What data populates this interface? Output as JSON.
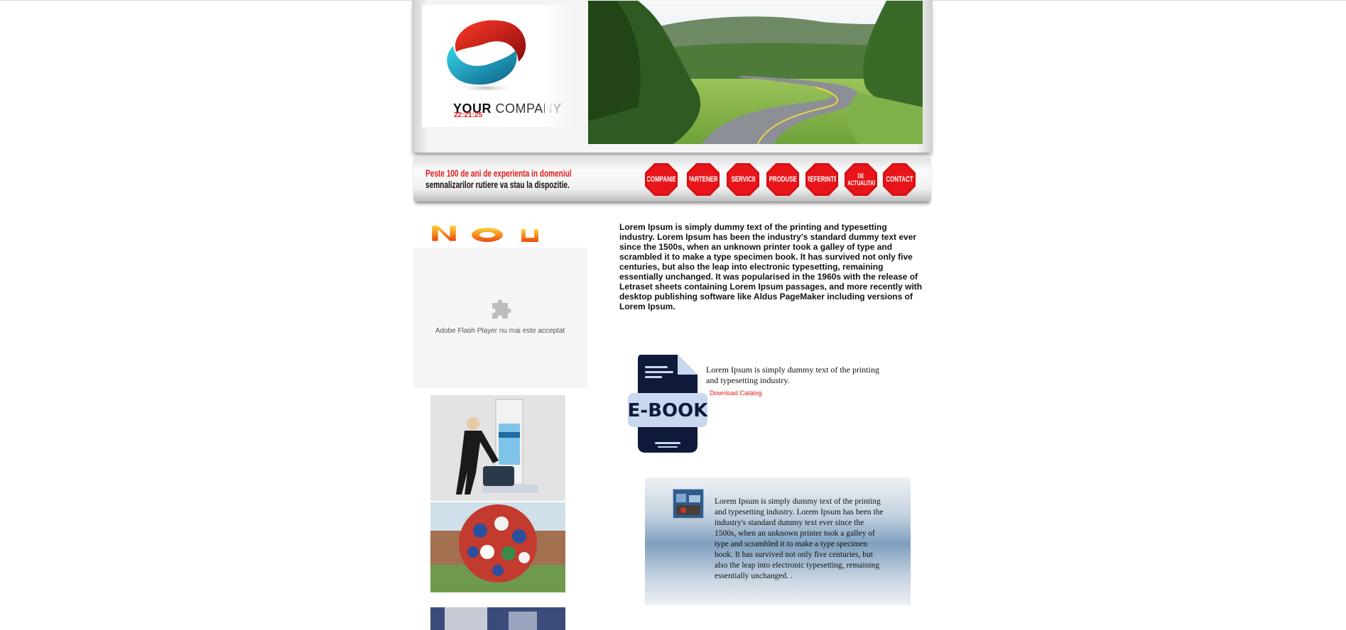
{
  "header": {
    "logo": {
      "brand_bold": "YOUR",
      "brand_regular": "COMPANY"
    },
    "clock": "22:21:25"
  },
  "nav": {
    "slogan_line1": "Peste 100 de ani de experienta in domeniul",
    "slogan_line2": "semnalizarilor rutiere va stau la dispozitie.",
    "items": [
      {
        "label": "COMPANIE"
      },
      {
        "label": "PARTENERI"
      },
      {
        "label": "SERVICII"
      },
      {
        "label": "PRODUSE"
      },
      {
        "label": "REFERINTE"
      },
      {
        "label": "DE ACTUALITATE"
      },
      {
        "label": "CONTACT"
      }
    ]
  },
  "left": {
    "heading_graphic": "N o u",
    "flash_message": "Adobe Flash Player nu mai este acceptat"
  },
  "main": {
    "intro": "Lorem Ipsum is simply dummy text of the printing and typesetting industry. Lorem Ipsum has been the industry's standard dummy text ever since the 1500s, when an unknown printer took a galley of type and scrambled it to make a type specimen book. It has survived not only five centuries, but also the leap into electronic typesetting, remaining essentially unchanged. It was popularised in the 1960s with the release of Letraset sheets containing Lorem Ipsum passages, and more recently with desktop publishing software like Aldus PageMaker including versions of Lorem Ipsum.",
    "ebook_label": "E-BOOK",
    "catalog_text": "Lorem Ipsum is simply dummy text of the printing and typesetting industry.",
    "catalog_link": "Download Catalog",
    "info_text": "Lorem Ipsum is simply dummy text of the printing and typesetting industry. Lorem Ipsum has been the industry's standard dummy text ever since the 1500s, when an unknown printer took a galley of type and scrambled it to make a type specimen book. It has survived not only five centuries, but also the leap into electronic typesetting, remaining essentially unchanged. ."
  },
  "colors": {
    "accent_red": "#e21a1a",
    "stop_sign_red": "#d90f14",
    "ebook_navy": "#0f1a3a",
    "ebook_light": "#c8d8f0"
  }
}
